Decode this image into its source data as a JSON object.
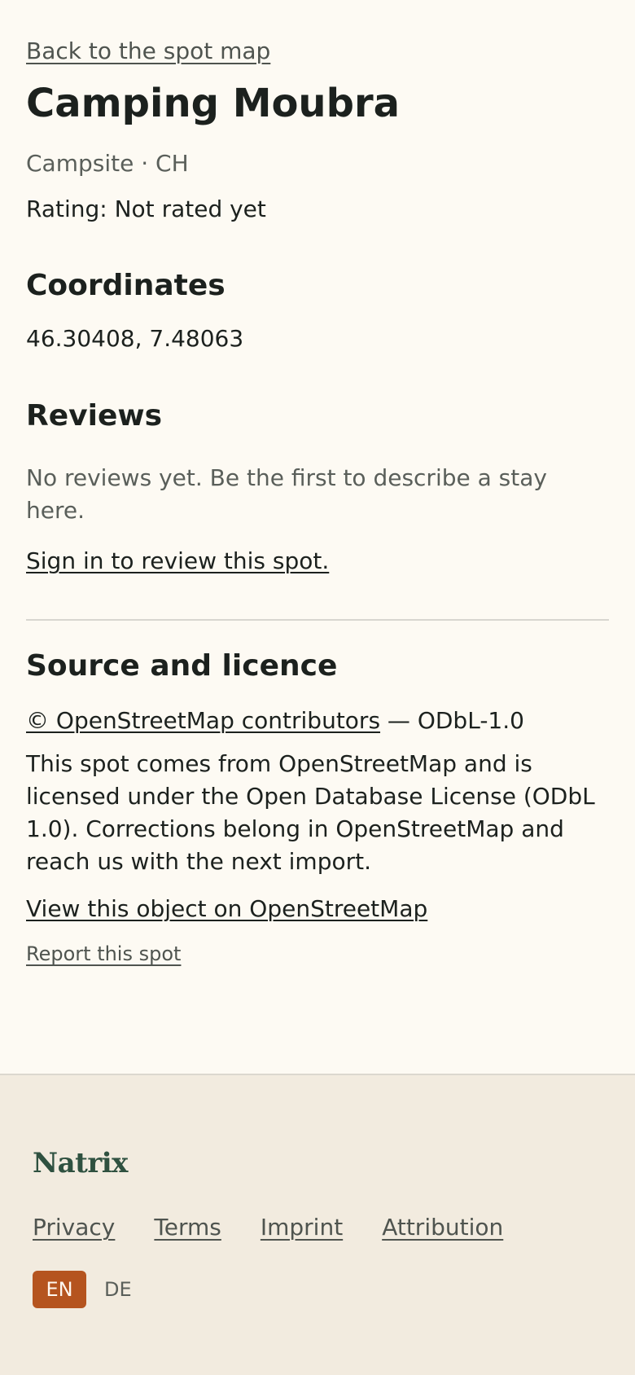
{
  "nav": {
    "back_label": "Back to the spot map"
  },
  "spot": {
    "name": "Camping Moubra",
    "subtitle": "Campsite · CH",
    "rating": "Rating: Not rated yet"
  },
  "coordinates": {
    "heading": "Coordinates",
    "value": "46.30408, 7.48063"
  },
  "reviews": {
    "heading": "Reviews",
    "empty_text": "No reviews yet. Be the first to describe a stay here.",
    "signin_label": "Sign in to review this spot."
  },
  "licence": {
    "heading": "Source and licence",
    "osm_link": "© OpenStreetMap contributors",
    "suffix": " — ODbL-1.0",
    "description": "This spot comes from OpenStreetMap and is licensed under the Open Database License (ODbL 1.0). Corrections belong in OpenStreetMap and reach us with the next import.",
    "view_object_label": "View this object on OpenStreetMap",
    "report_label": "Report this spot"
  },
  "footer": {
    "brand": "Natrix",
    "links": [
      "Privacy",
      "Terms",
      "Imprint",
      "Attribution"
    ],
    "languages": {
      "active": "EN",
      "other": "DE"
    }
  },
  "colors": {
    "accent": "#b5541f",
    "brand": "#2f5140",
    "background": "#fdfaf3",
    "footer_background": "#f2ebdf"
  }
}
